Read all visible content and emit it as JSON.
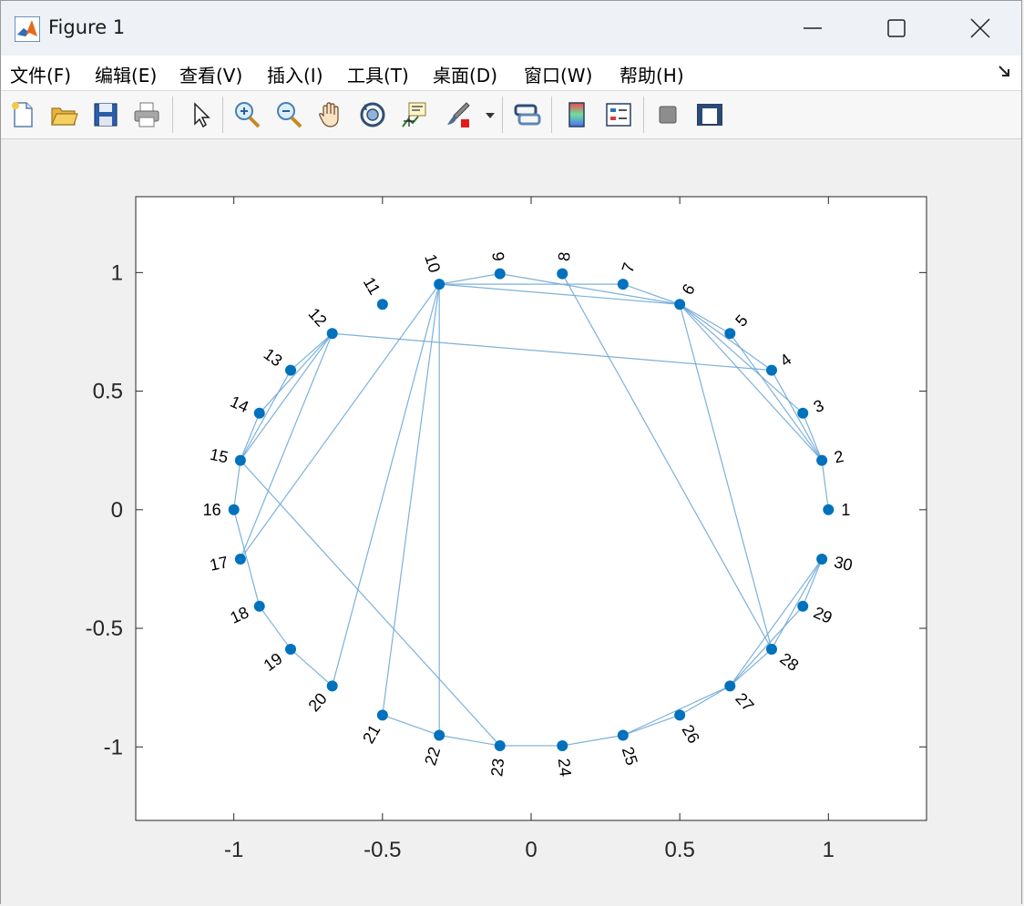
{
  "window": {
    "title": "Figure 1"
  },
  "menu": [
    "文件(F)",
    "编辑(E)",
    "查看(V)",
    "插入(I)",
    "工具(T)",
    "桌面(D)",
    "窗口(W)",
    "帮助(H)"
  ],
  "toolbar": [
    "new-figure-icon",
    "open-file-icon",
    "save-icon",
    "print-icon",
    "select-arrow-icon",
    "zoom-in-icon",
    "zoom-out-icon",
    "pan-hand-icon",
    "rotate-3d-icon",
    "data-cursor-icon",
    "brush-icon",
    "brush-dropdown-icon",
    "link-plot-icon",
    "colorbar-icon",
    "legend-icon",
    "hide-plot-tools-icon",
    "show-plot-tools-icon"
  ],
  "colors": {
    "node": "#0072bd",
    "edge": "#6fa8d6",
    "axes_background": "#ffffff",
    "figure_background": "#f0f0f0"
  },
  "chart_data": {
    "type": "graph",
    "layout": "circle",
    "xlim": [
      -1.33,
      1.33
    ],
    "ylim": [
      -1.31,
      1.32
    ],
    "xticks": [
      -1,
      -0.5,
      0,
      0.5,
      1
    ],
    "xtick_labels": [
      "-1",
      "-0.5",
      "0",
      "0.5",
      "1"
    ],
    "yticks": [
      1,
      0.5,
      0,
      -0.5,
      -1
    ],
    "ytick_labels": [
      "1",
      "0.5",
      "0",
      "-0.5",
      "-1"
    ],
    "nodes": [
      {
        "label": "1",
        "x": 1.0,
        "y": 0.0
      },
      {
        "label": "2",
        "x": 0.978,
        "y": 0.208
      },
      {
        "label": "3",
        "x": 0.914,
        "y": 0.407
      },
      {
        "label": "4",
        "x": 0.809,
        "y": 0.588
      },
      {
        "label": "5",
        "x": 0.669,
        "y": 0.743
      },
      {
        "label": "6",
        "x": 0.5,
        "y": 0.866
      },
      {
        "label": "7",
        "x": 0.309,
        "y": 0.951
      },
      {
        "label": "8",
        "x": 0.105,
        "y": 0.995
      },
      {
        "label": "9",
        "x": -0.105,
        "y": 0.995
      },
      {
        "label": "10",
        "x": -0.309,
        "y": 0.951
      },
      {
        "label": "11",
        "x": -0.5,
        "y": 0.866
      },
      {
        "label": "12",
        "x": -0.669,
        "y": 0.743
      },
      {
        "label": "13",
        "x": -0.809,
        "y": 0.588
      },
      {
        "label": "14",
        "x": -0.914,
        "y": 0.407
      },
      {
        "label": "15",
        "x": -0.978,
        "y": 0.208
      },
      {
        "label": "16",
        "x": -1.0,
        "y": 0.0
      },
      {
        "label": "17",
        "x": -0.978,
        "y": -0.208
      },
      {
        "label": "18",
        "x": -0.914,
        "y": -0.407
      },
      {
        "label": "19",
        "x": -0.809,
        "y": -0.588
      },
      {
        "label": "20",
        "x": -0.669,
        "y": -0.743
      },
      {
        "label": "21",
        "x": -0.5,
        "y": -0.866
      },
      {
        "label": "22",
        "x": -0.309,
        "y": -0.951
      },
      {
        "label": "23",
        "x": -0.105,
        "y": -0.995
      },
      {
        "label": "24",
        "x": 0.105,
        "y": -0.995
      },
      {
        "label": "25",
        "x": 0.309,
        "y": -0.951
      },
      {
        "label": "26",
        "x": 0.5,
        "y": -0.866
      },
      {
        "label": "27",
        "x": 0.669,
        "y": -0.743
      },
      {
        "label": "28",
        "x": 0.809,
        "y": -0.588
      },
      {
        "label": "29",
        "x": 0.914,
        "y": -0.407
      },
      {
        "label": "30",
        "x": 0.978,
        "y": -0.208
      }
    ],
    "edges": [
      [
        1,
        2
      ],
      [
        2,
        3
      ],
      [
        2,
        4
      ],
      [
        2,
        5
      ],
      [
        2,
        6
      ],
      [
        3,
        6
      ],
      [
        4,
        6
      ],
      [
        4,
        12
      ],
      [
        5,
        6
      ],
      [
        6,
        7
      ],
      [
        6,
        10
      ],
      [
        6,
        9
      ],
      [
        6,
        28
      ],
      [
        7,
        10
      ],
      [
        8,
        28
      ],
      [
        9,
        10
      ],
      [
        10,
        20
      ],
      [
        10,
        21
      ],
      [
        10,
        22
      ],
      [
        10,
        17
      ],
      [
        12,
        13
      ],
      [
        12,
        14
      ],
      [
        12,
        15
      ],
      [
        12,
        17
      ],
      [
        13,
        15
      ],
      [
        14,
        15
      ],
      [
        15,
        16
      ],
      [
        15,
        23
      ],
      [
        16,
        18
      ],
      [
        18,
        19
      ],
      [
        19,
        20
      ],
      [
        21,
        22
      ],
      [
        22,
        23
      ],
      [
        23,
        24
      ],
      [
        24,
        25
      ],
      [
        25,
        26
      ],
      [
        25,
        27
      ],
      [
        26,
        27
      ],
      [
        27,
        28
      ],
      [
        27,
        29
      ],
      [
        27,
        30
      ],
      [
        28,
        30
      ],
      [
        29,
        30
      ]
    ]
  }
}
